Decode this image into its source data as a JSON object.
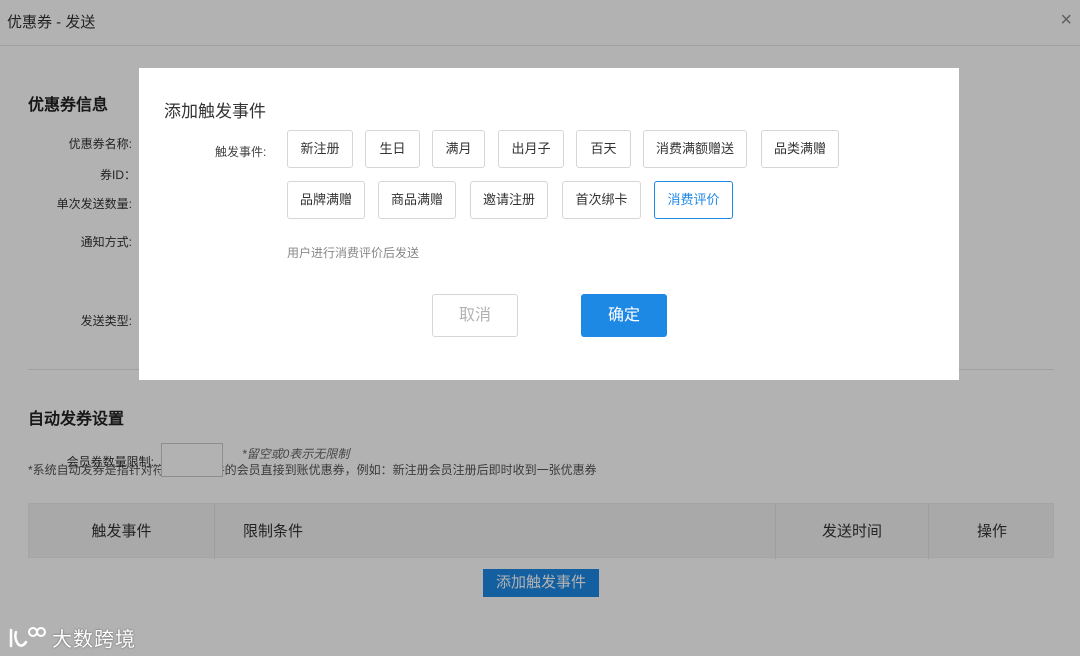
{
  "window": {
    "title": "优惠券 - 发送",
    "close_icon": "×"
  },
  "coupon_info": {
    "title": "优惠券信息",
    "fields": [
      "优惠券名称:",
      "券ID：",
      "单次发送数量:",
      "通知方式:",
      "发送类型:"
    ]
  },
  "auto": {
    "title": "自动发券设置",
    "note": "*系统自动发券是指针对符合选择条件的会员直接到账优惠券，例如：新注册会员注册后即时收到一张优惠券",
    "limit_label": "会员券数量限制:",
    "limit_value": "",
    "limit_hint": "*留空或0表示无限制",
    "table_headers": [
      "触发事件",
      "限制条件",
      "发送时间",
      "操作"
    ],
    "add_button": "添加触发事件"
  },
  "modal": {
    "title": "添加触发事件",
    "trigger_label": "触发事件:",
    "tags": [
      "新注册",
      "生日",
      "满月",
      "出月子",
      "百天",
      "消费满额赠送",
      "品类满赠",
      "品牌满赠",
      "商品满赠",
      "邀请注册",
      "首次绑卡",
      "消费评价"
    ],
    "selected": "消费评价",
    "description": "用户进行消费评价后发送",
    "cancel": "取消",
    "confirm": "确定"
  },
  "watermark": {
    "text": "大数跨境",
    "logo_icon": "dashuju-logo-icon"
  },
  "colors": {
    "accent": "#1e88e5",
    "overlay": "rgba(0,0,0,0.30)"
  }
}
